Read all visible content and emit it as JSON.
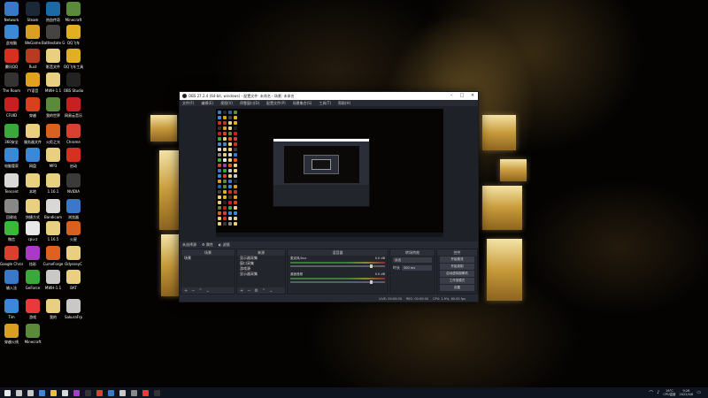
{
  "desktop_icons": [
    {
      "label": "Network",
      "color": "#3a78c8"
    },
    {
      "label": "Steam",
      "color": "#1b2838"
    },
    {
      "label": "热血传奇",
      "color": "#1a6aa8"
    },
    {
      "label": "Minecraft",
      "color": "#5a8a3a"
    },
    {
      "label": "此电脑",
      "color": "#3a8ad8"
    },
    {
      "label": "WeGame",
      "color": "#d8a020"
    },
    {
      "label": "Battlestate Games",
      "color": "#444"
    },
    {
      "label": "QQ飞车",
      "color": "#e0b020"
    },
    {
      "label": "腾讯QQ",
      "color": "#d83020"
    },
    {
      "label": "Rust",
      "color": "#b83a20"
    },
    {
      "label": "影音文件",
      "color": "#e8d080"
    },
    {
      "label": "QQ飞车工具",
      "color": "#e0b020"
    },
    {
      "label": "The Room",
      "color": "#333"
    },
    {
      "label": "YY语音",
      "color": "#e0a020"
    },
    {
      "label": "MWH-1.1",
      "color": "#e8d080"
    },
    {
      "label": "OBS Studio",
      "color": "#222"
    },
    {
      "label": "CFUID",
      "color": "#c82020"
    },
    {
      "label": "穿越",
      "color": "#d84020"
    },
    {
      "label": "我的世界",
      "color": "#5a8a3a"
    },
    {
      "label": "网易云音乐",
      "color": "#c82020"
    },
    {
      "label": "360安全",
      "color": "#3aa83a"
    },
    {
      "label": "服务器文件",
      "color": "#e8d080"
    },
    {
      "label": "火炬之光",
      "color": "#d86020"
    },
    {
      "label": "Chrome",
      "color": "#d84030"
    },
    {
      "label": "电脑管家",
      "color": "#3a88d8"
    },
    {
      "label": "网盘",
      "color": "#3a88d8"
    },
    {
      "label": "MP3",
      "color": "#e8d080"
    },
    {
      "label": "启动",
      "color": "#d83020"
    },
    {
      "label": "Tencent",
      "color": "#d8d8d8"
    },
    {
      "label": "本地",
      "color": "#e8d080"
    },
    {
      "label": "1.16.1",
      "color": "#e8d080"
    },
    {
      "label": "NVIDIA",
      "color": "#3a3a3a"
    },
    {
      "label": "回收站",
      "color": "#888"
    },
    {
      "label": "快捷方式",
      "color": "#e8d080"
    },
    {
      "label": "Bandicam",
      "color": "#d8d8d8"
    },
    {
      "label": "浏览器",
      "color": "#3a78c8"
    },
    {
      "label": "微信",
      "color": "#3ab83a"
    },
    {
      "label": "cpu-z",
      "color": "#e8e8e8"
    },
    {
      "label": "1.16.5",
      "color": "#e8d080"
    },
    {
      "label": "火星",
      "color": "#d86020"
    },
    {
      "label": "Google Chrome",
      "color": "#d84030"
    },
    {
      "label": "炫彩",
      "color": "#a83ac8"
    },
    {
      "label": "CurseForge",
      "color": "#e06020"
    },
    {
      "label": "OdysseyC",
      "color": "#e8d080"
    },
    {
      "label": "输入法",
      "color": "#3a78c8"
    },
    {
      "label": "GeForce",
      "color": "#3aa83a"
    },
    {
      "label": "MWH-1.1",
      "color": "#c8c8c8"
    },
    {
      "label": "BAT",
      "color": "#e8d080"
    },
    {
      "label": "Tim",
      "color": "#3a88d8"
    },
    {
      "label": "游戏",
      "color": "#e83a3a"
    },
    {
      "label": "我的",
      "color": "#e8d080"
    },
    {
      "label": "SakuraFrp",
      "color": "#c8c8c8"
    },
    {
      "label": "穿越火线",
      "color": "#d8a020"
    },
    {
      "label": "Minecraft",
      "color": "#5a8a3a"
    }
  ],
  "obs": {
    "title": "OBS 27.2.4 (64-bit, windows) - 配置文件: 未命名 - 场景: 未命名",
    "menu": [
      "文件(F)",
      "编辑(E)",
      "视图(V)",
      "停靠窗口(D)",
      "配置文件(P)",
      "场景集合(S)",
      "工具(T)",
      "帮助(H)"
    ],
    "scene_tab_label": "未选择源",
    "scene_tab_props": "属性",
    "scene_tab_filters": "滤镜",
    "docks": {
      "scenes": {
        "title": "场景",
        "items": [
          "场景"
        ]
      },
      "sources": {
        "title": "来源",
        "items": [
          "显示器采集",
          "窗口采集",
          "游戏源",
          "显示器采集"
        ]
      },
      "mixer": {
        "title": "混音器",
        "channels": [
          {
            "name": "麦克风/Aux",
            "db": "0.0 dB"
          },
          {
            "name": "桌面音频",
            "db": "0.0 dB"
          }
        ]
      },
      "transitions": {
        "title": "转场特效",
        "type": "淡出",
        "duration_label": "时长",
        "duration": "300 ms"
      },
      "controls": {
        "title": "控件",
        "buttons": [
          "开始推流",
          "开始录制",
          "启动虚拟摄像机",
          "工作室模式",
          "设置",
          "退出"
        ]
      }
    },
    "status": [
      "LIVE: 00:00:00",
      "REC: 00:00:00",
      "CPU: 1.9%, 60.00 fps"
    ]
  },
  "taskbar": {
    "icons": [
      {
        "name": "start",
        "color": "#e8e8e8"
      },
      {
        "name": "search",
        "color": "#c8c8c8"
      },
      {
        "name": "task-view",
        "color": "#c8c8c8"
      },
      {
        "name": "edge",
        "color": "#3a88d8"
      },
      {
        "name": "explorer",
        "color": "#e8c040"
      },
      {
        "name": "app",
        "color": "#d8d8d8"
      },
      {
        "name": "app",
        "color": "#a83ac8"
      },
      {
        "name": "app",
        "color": "#333"
      },
      {
        "name": "chrome",
        "color": "#d84030"
      },
      {
        "name": "app",
        "color": "#3a78c8"
      },
      {
        "name": "app",
        "color": "#c8c8c8"
      },
      {
        "name": "app",
        "color": "#888"
      },
      {
        "name": "app",
        "color": "#e83a3a"
      },
      {
        "name": "obs",
        "color": "#333"
      }
    ],
    "weather": "16°C",
    "weather_desc": "CPU温度",
    "time": "9:26",
    "date": "2022/4/6"
  }
}
